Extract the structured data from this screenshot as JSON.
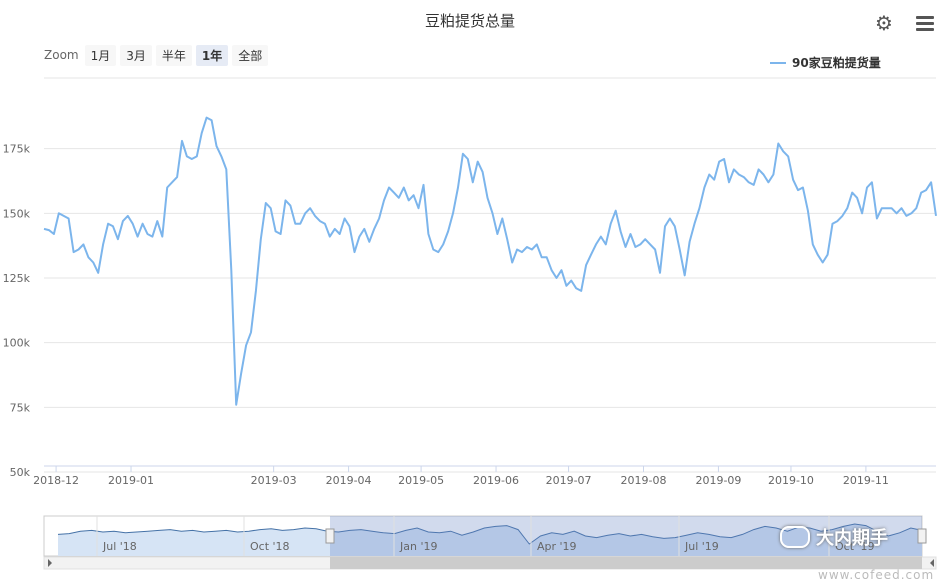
{
  "chart_data": {
    "type": "line",
    "title": "豆粕提货总量",
    "zoom_label": "Zoom",
    "zoom_buttons": [
      "1月",
      "3月",
      "半年",
      "1年",
      "全部"
    ],
    "zoom_active": "1年",
    "series": [
      {
        "name": "90家豆粕提货量",
        "color": "#7cb5ec",
        "values": [
          144000,
          143500,
          142000,
          150000,
          149000,
          148000,
          135000,
          136000,
          138000,
          133000,
          131000,
          127000,
          138000,
          146000,
          145000,
          140000,
          147000,
          149000,
          146000,
          141000,
          146000,
          142000,
          141000,
          147000,
          141000,
          160000,
          162000,
          164000,
          178000,
          172000,
          171000,
          172000,
          181000,
          187000,
          186000,
          176000,
          172000,
          167000,
          128000,
          76000,
          88000,
          99000,
          104000,
          120000,
          140000,
          154000,
          152000,
          143000,
          142000,
          155000,
          153000,
          146000,
          146000,
          150000,
          152000,
          149000,
          147000,
          146000,
          141000,
          144000,
          142000,
          148000,
          145000,
          135000,
          141000,
          144000,
          139000,
          144000,
          148000,
          155000,
          160000,
          158000,
          156000,
          160000,
          155000,
          157000,
          152000,
          161000,
          142000,
          136000,
          135000,
          138000,
          143000,
          150000,
          160000,
          173000,
          171000,
          162000,
          170000,
          166000,
          156000,
          150000,
          142000,
          148000,
          140000,
          131000,
          136000,
          135000,
          137000,
          136000,
          138000,
          133000,
          133000,
          128000,
          125000,
          128000,
          122000,
          124000,
          121000,
          120000,
          130000,
          134000,
          138000,
          141000,
          138000,
          146000,
          151000,
          143000,
          137000,
          142000,
          137000,
          138000,
          140000,
          138000,
          136000,
          127000,
          145000,
          148000,
          145000,
          136000,
          126000,
          139000,
          146000,
          152000,
          160000,
          165000,
          163000,
          170000,
          171000,
          162000,
          167000,
          165000,
          164000,
          162000,
          161000,
          167000,
          165000,
          162000,
          165000,
          177000,
          174000,
          172000,
          163000,
          159000,
          160000,
          151000,
          138000,
          134000,
          131000,
          134000,
          146000,
          147000,
          149000,
          152000,
          158000,
          156000,
          150000,
          160000,
          162000,
          148000,
          152000,
          152000,
          152000,
          150000,
          152000,
          149000,
          150000,
          152000,
          158000,
          159000,
          162000,
          149000
        ]
      }
    ],
    "y_ticks": [
      "50k",
      "75k",
      "100k",
      "125k",
      "150k",
      "175k"
    ],
    "y_tick_values": [
      50000,
      75000,
      100000,
      125000,
      150000,
      175000
    ],
    "ylim": [
      50000,
      200000
    ],
    "x_ticks": [
      "2018-12",
      "2019-01",
      "2019-03",
      "2019-04",
      "2019-05",
      "2019-06",
      "2019-07",
      "2019-08",
      "2019-09",
      "2019-10",
      "2019-11"
    ],
    "x_range": [
      "2018-11-26",
      "2019-11-30"
    ],
    "x_tick_dates": [
      "2018-12-01",
      "2019-01-01",
      "2019-03-01",
      "2019-04-01",
      "2019-05-01",
      "2019-06-01",
      "2019-07-01",
      "2019-08-01",
      "2019-09-01",
      "2019-10-01",
      "2019-11-01"
    ],
    "navigator_labels": [
      "Jul '18",
      "Oct '18",
      "Jan '19",
      "Apr '19",
      "Jul '19",
      "Oct '19"
    ],
    "navigator_series": [
      142,
      143,
      146,
      147,
      145,
      146,
      144,
      145,
      146,
      147,
      148,
      146,
      147,
      145,
      146,
      147,
      145,
      146,
      148,
      149,
      147,
      148,
      150,
      149,
      146,
      145,
      147,
      148,
      146,
      144,
      143,
      147,
      150,
      145,
      144,
      146,
      141,
      145,
      150,
      152,
      153,
      148,
      130,
      140,
      144,
      142,
      146,
      140,
      138,
      141,
      143,
      140,
      142,
      139,
      137,
      138,
      141,
      144,
      142,
      139,
      138,
      142,
      148,
      152,
      150,
      146,
      151,
      150,
      146,
      148,
      152,
      155,
      153,
      146,
      140,
      144,
      150,
      147
    ],
    "grid": true,
    "legend_position": "top-right"
  },
  "watermark": "大内期手",
  "url": "www.cofeed.com"
}
